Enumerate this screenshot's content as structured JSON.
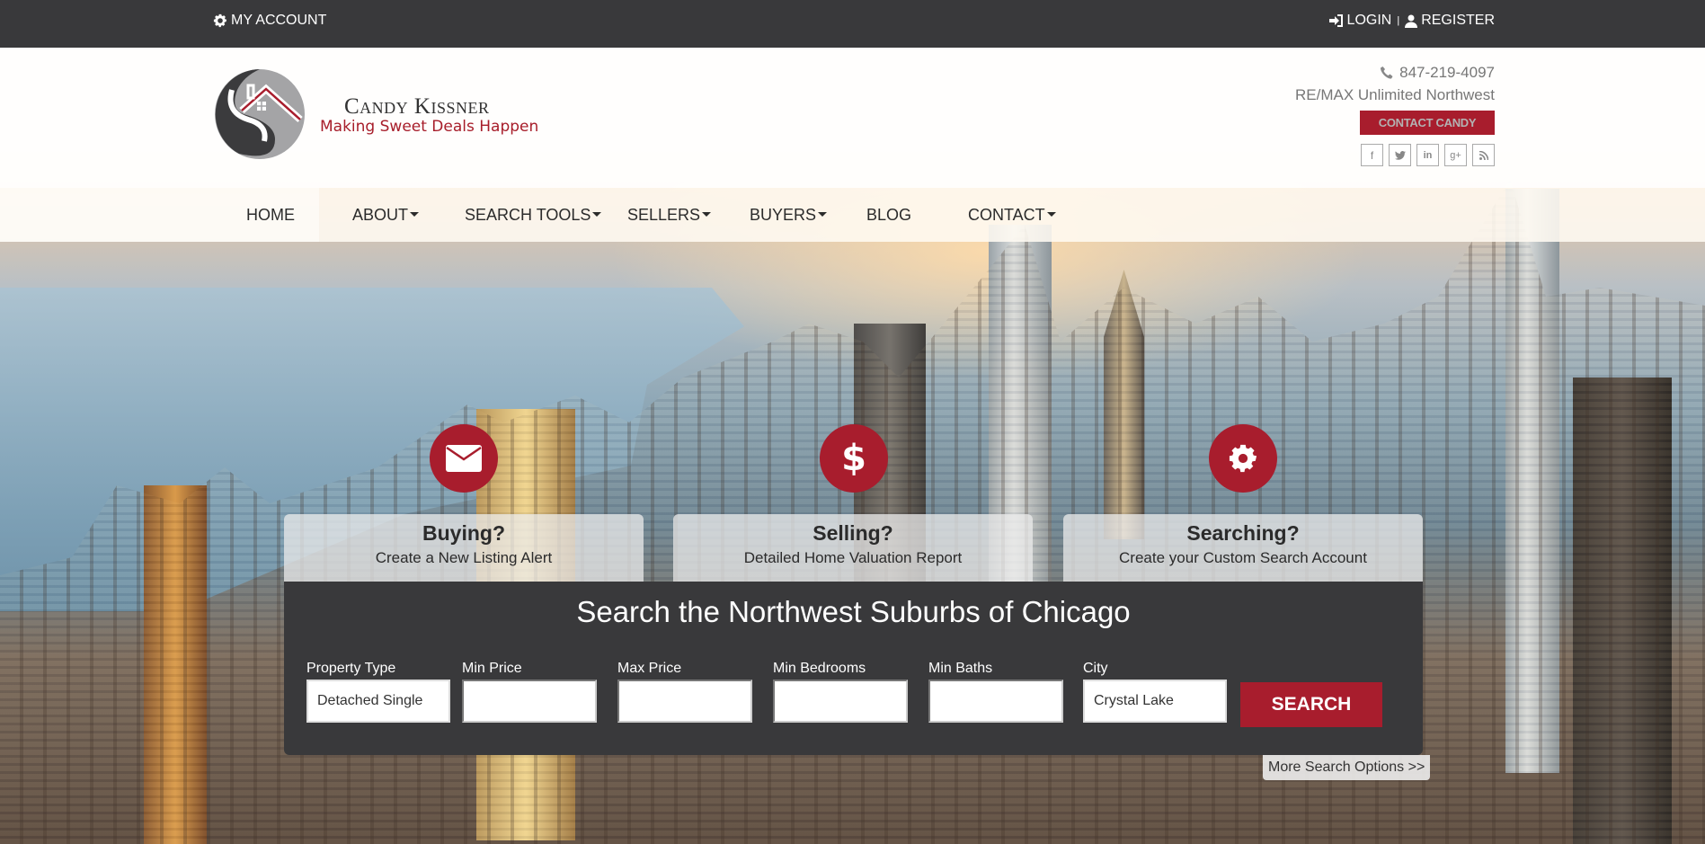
{
  "topbar": {
    "account_label": "MY ACCOUNT",
    "account_icon": "gear-icon",
    "login_label": "LOGIN",
    "login_icon": "sign-in-icon",
    "separator": "|",
    "register_label": "REGISTER",
    "register_icon": "user-icon"
  },
  "header": {
    "logo_name": "Candy Kissner",
    "logo_tagline": "Making Sweet Deals Happen",
    "phone": "847-219-4097",
    "brokerage": "RE/MAX Unlimited Northwest",
    "contact_button": "CONTACT CANDY",
    "social": [
      {
        "icon": "facebook-icon",
        "glyph": "f"
      },
      {
        "icon": "twitter-icon",
        "glyph": "🐦"
      },
      {
        "icon": "linkedin-icon",
        "glyph": "in"
      },
      {
        "icon": "google-plus-icon",
        "glyph": "g+"
      },
      {
        "icon": "rss-icon",
        "glyph": "≋"
      }
    ]
  },
  "nav": {
    "items": [
      {
        "label": "HOME",
        "dropdown": false
      },
      {
        "label": "ABOUT",
        "dropdown": true
      },
      {
        "label": "SEARCH TOOLS",
        "dropdown": true
      },
      {
        "label": "SELLERS",
        "dropdown": true
      },
      {
        "label": "BUYERS",
        "dropdown": true
      },
      {
        "label": "BLOG",
        "dropdown": false
      },
      {
        "label": "CONTACT",
        "dropdown": true
      }
    ]
  },
  "features": [
    {
      "icon": "envelope-icon",
      "title": "Buying?",
      "desc": "Create a New Listing Alert"
    },
    {
      "icon": "dollar-icon",
      "title": "Selling?",
      "desc": "Detailed Home Valuation Report"
    },
    {
      "icon": "gear-icon",
      "title": "Searching?",
      "desc": "Create your Custom Search Account"
    }
  ],
  "search": {
    "title": "Search the Northwest Suburbs of Chicago",
    "fields": [
      {
        "label": "Property Type",
        "value": "Detached Single",
        "type": "select"
      },
      {
        "label": "Min Price",
        "value": "",
        "type": "input"
      },
      {
        "label": "Max Price",
        "value": "",
        "type": "input"
      },
      {
        "label": "Min Bedrooms",
        "value": "",
        "type": "input"
      },
      {
        "label": "Min Baths",
        "value": "",
        "type": "input"
      },
      {
        "label": "City",
        "value": "Crystal Lake",
        "type": "input"
      }
    ],
    "button": "SEARCH",
    "more_options": "More Search Options >>"
  },
  "colors": {
    "brand_red": "#a81d2d",
    "dark_bar": "#39393b"
  }
}
